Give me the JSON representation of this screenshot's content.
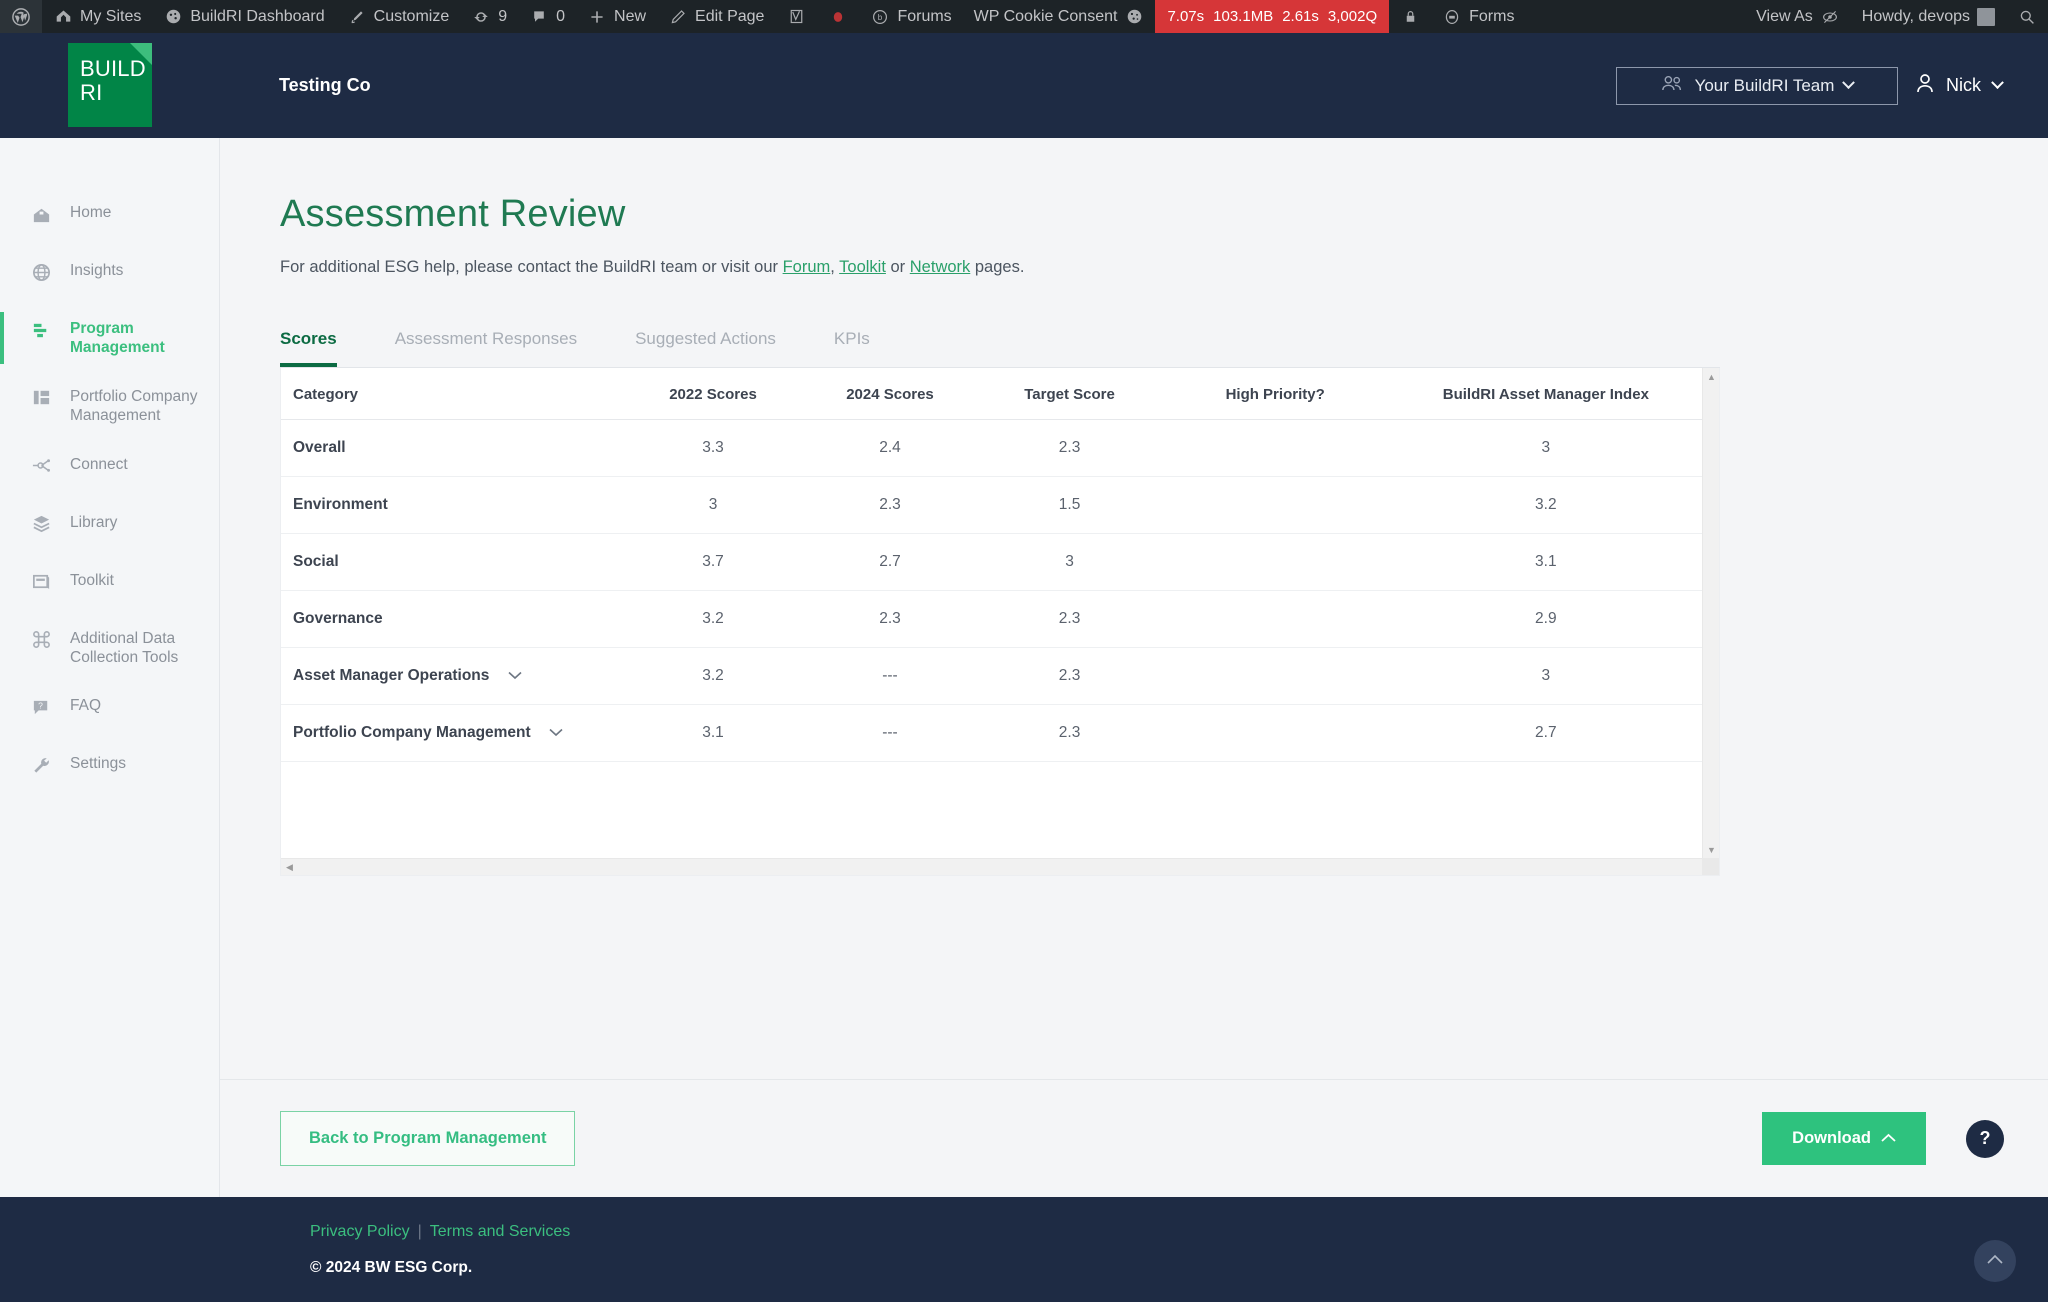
{
  "admin_bar": {
    "left_items": [
      {
        "icon": "wordpress-icon",
        "label": ""
      },
      {
        "icon": "sites-icon",
        "label": "My Sites"
      },
      {
        "icon": "dashboard-icon",
        "label": "BuildRI Dashboard"
      },
      {
        "icon": "brush-icon",
        "label": "Customize"
      },
      {
        "icon": "updates-icon",
        "label": "9"
      },
      {
        "icon": "comment-icon",
        "label": "0"
      },
      {
        "icon": "plus-icon",
        "label": "New"
      },
      {
        "icon": "pencil-icon",
        "label": "Edit Page"
      },
      {
        "icon": "validator-icon",
        "label": ""
      },
      {
        "icon": "record-dot-icon",
        "label": ""
      },
      {
        "icon": "forums-icon",
        "label": "Forums"
      },
      {
        "icon": "cookie-icon",
        "label": "WP Cookie Consent"
      }
    ],
    "performance": {
      "time": "7.07s",
      "memory": "103.1MB",
      "load": "2.61s",
      "queries": "3,002Q"
    },
    "after_perf_items": [
      {
        "icon": "lock-icon",
        "label": ""
      },
      {
        "icon": "forms-icon",
        "label": "Forms"
      }
    ],
    "right_items": [
      {
        "icon": "view-as-icon",
        "label": "View As"
      },
      {
        "icon": "user-avatar-icon",
        "label": "Howdy, devops"
      },
      {
        "icon": "search-icon",
        "label": ""
      }
    ]
  },
  "header": {
    "logo_line1": "BUILD",
    "logo_line2": "RI",
    "company_name": "Testing Co",
    "team_switcher_label": "Your BuildRI Team",
    "user_name": "Nick"
  },
  "sidebar": {
    "items": [
      {
        "label": "Home",
        "icon": "home-icon",
        "active": false
      },
      {
        "label": "Insights",
        "icon": "globe-icon",
        "active": false
      },
      {
        "label": "Program Management",
        "icon": "program-icon",
        "active": true
      },
      {
        "label": "Portfolio Company Management",
        "icon": "portfolio-icon",
        "active": false
      },
      {
        "label": "Connect",
        "icon": "connect-icon",
        "active": false
      },
      {
        "label": "Library",
        "icon": "layers-icon",
        "active": false
      },
      {
        "label": "Toolkit",
        "icon": "toolkit-icon",
        "active": false
      },
      {
        "label": "Additional Data Collection Tools",
        "icon": "command-icon",
        "active": false
      },
      {
        "label": "FAQ",
        "icon": "faq-icon",
        "active": false
      },
      {
        "label": "Settings",
        "icon": "wrench-icon",
        "active": false
      }
    ]
  },
  "main": {
    "page_title": "Assessment Review",
    "intro": {
      "prefix": "For additional ESG help, please contact the BuildRI team or visit our ",
      "link1": "Forum",
      "sep1": ", ",
      "link2": "Toolkit",
      "sep2": " or ",
      "link3": "Network",
      "suffix": " pages."
    },
    "tabs": [
      {
        "label": "Scores",
        "active": true
      },
      {
        "label": "Assessment Responses",
        "active": false
      },
      {
        "label": "Suggested Actions",
        "active": false
      },
      {
        "label": "KPIs",
        "active": false
      }
    ],
    "table": {
      "columns": [
        "Category",
        "2022 Scores",
        "2024 Scores",
        "Target Score",
        "High Priority?",
        "BuildRI Asset Manager Index"
      ],
      "rows": [
        {
          "category": "Overall",
          "expandable": false,
          "s2022": "3.3",
          "s2024": "2.4",
          "target": "2.3",
          "high_priority": "",
          "index": "3"
        },
        {
          "category": "Environment",
          "expandable": false,
          "s2022": "3",
          "s2024": "2.3",
          "target": "1.5",
          "high_priority": "",
          "index": "3.2"
        },
        {
          "category": "Social",
          "expandable": false,
          "s2022": "3.7",
          "s2024": "2.7",
          "target": "3",
          "high_priority": "",
          "index": "3.1"
        },
        {
          "category": "Governance",
          "expandable": false,
          "s2022": "3.2",
          "s2024": "2.3",
          "target": "2.3",
          "high_priority": "",
          "index": "2.9"
        },
        {
          "category": "Asset Manager Operations",
          "expandable": true,
          "s2022": "3.2",
          "s2024": "---",
          "target": "2.3",
          "high_priority": "",
          "index": "3"
        },
        {
          "category": "Portfolio Company Management",
          "expandable": true,
          "s2022": "3.1",
          "s2024": "---",
          "target": "2.3",
          "high_priority": "",
          "index": "2.7"
        }
      ]
    }
  },
  "action_bar": {
    "back_label": "Back to Program Management",
    "download_label": "Download",
    "help_label": "?"
  },
  "footer": {
    "privacy": "Privacy Policy",
    "separator": "|",
    "terms": "Terms and Services",
    "copyright": "© 2024 BW ESG Corp."
  },
  "colors": {
    "brand_green": "#018547",
    "accent_green": "#3bbf7f",
    "title_green": "#1f7a52",
    "header_navy": "#1e2b44",
    "admin_bar": "#1d2327",
    "perf_red": "#d63638"
  }
}
